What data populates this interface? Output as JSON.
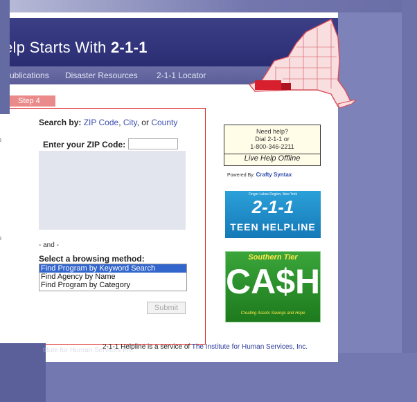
{
  "header": {
    "title_prefix": "elp Starts With ",
    "title_bold": "2-1-1"
  },
  "nav": {
    "items": [
      "Publications",
      "Disaster Resources",
      "2-1-1 Locator"
    ]
  },
  "step_tab": "Step 4",
  "search": {
    "label": "Search by:",
    "options": [
      "ZIP Code",
      ", ",
      "City",
      ", or ",
      "County"
    ],
    "zip_label": "Enter your ZIP Code:",
    "zip_value": "",
    "and_label": "- and -",
    "browse_label": "Select a browsing method:",
    "browse_options": [
      "Find Program by Keyword Search",
      "Find Agency by Name",
      "Find Program by Category"
    ],
    "browse_selected": "Find Program by Keyword Search",
    "submit": "Submit"
  },
  "sidebar": {
    "live_help": {
      "line1": "Need help?",
      "line2": "Dial 2-1-1 or",
      "line3": "1-800-346-2211",
      "status": "Live Help Offline"
    },
    "powered_by": "Powered By:",
    "powered_brand": "Crafty Syntax",
    "teen": {
      "small": "Finger Lakes Region, New York",
      "big": "2-1-1",
      "name": "TEEN HELPLINE"
    },
    "cash": {
      "region": "Southern Tier",
      "big": "CA$H",
      "tagline": "Creating Assets Savings and Hope"
    }
  },
  "footer": {
    "prefix": "2-1-1 Helpline is a service of ",
    "link": "The Institute for Human Services, Inc.",
    "ghost": "titute for Human Services Inc."
  },
  "colors": {
    "header_bg": "#2a2d72",
    "nav_bg": "#5a5d98",
    "panel_border": "#e02828",
    "step_tab": "#ea8a8a",
    "outer_bg": "#7d82b8"
  }
}
